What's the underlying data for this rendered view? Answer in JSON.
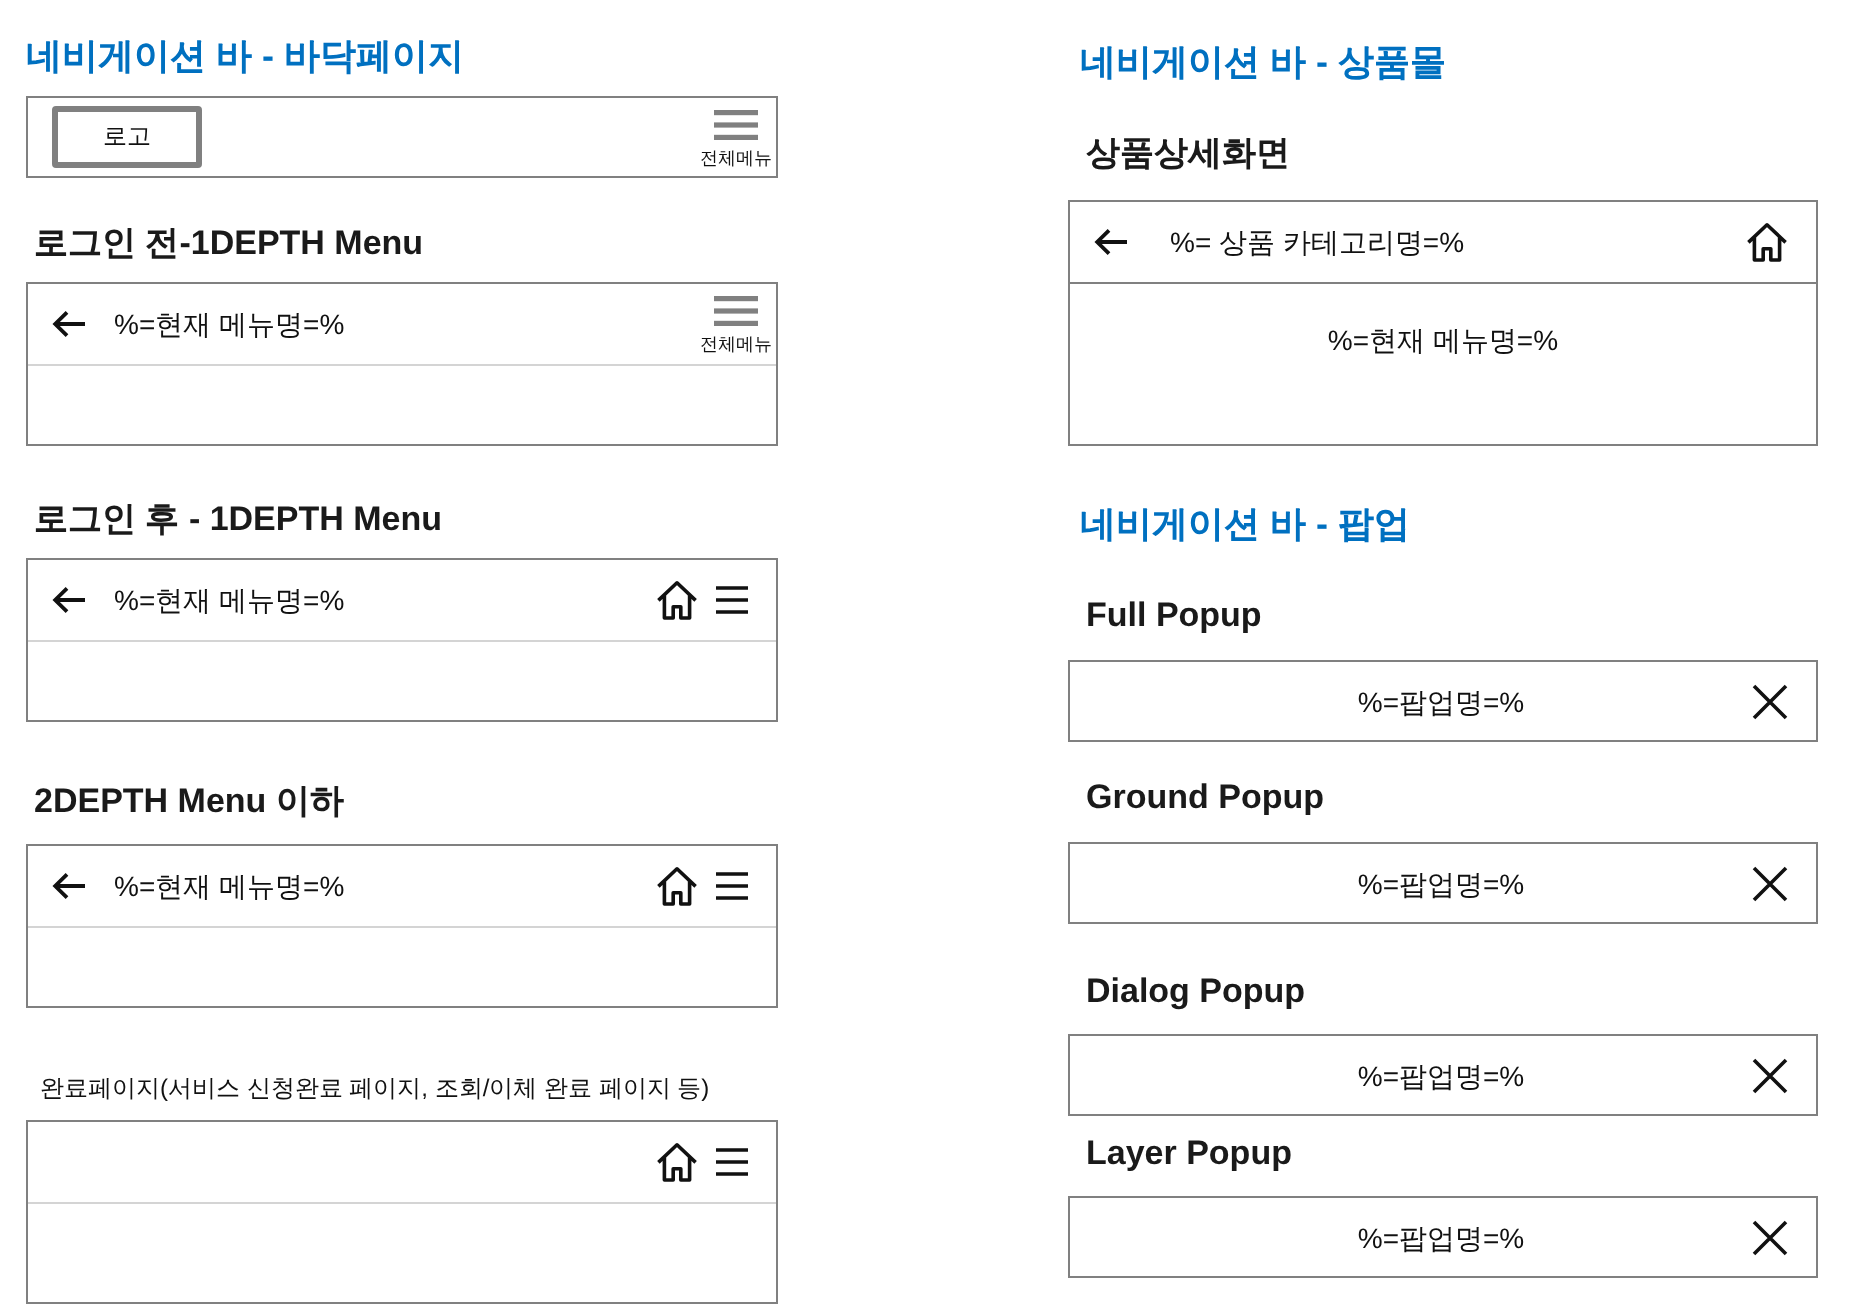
{
  "columns": [
    {
      "sections": [
        {
          "title": "네비게이션 바 - 바닥페이지",
          "bars": [
            {
              "kind": "base",
              "logo": "로고",
              "menu_label": "전체메뉴"
            },
            {
              "kind": "guest",
              "heading": "로그인 전-1DEPTH Menu",
              "title": "%=현재 메뉴명=%",
              "menu_label": "전체메뉴"
            },
            {
              "kind": "member",
              "heading": "로그인 후 - 1DEPTH Menu",
              "title": "%=현재 메뉴명=%"
            },
            {
              "kind": "member",
              "heading": "2DEPTH Menu 이하",
              "title": "%=현재 메뉴명=%"
            },
            {
              "kind": "done",
              "heading": "완료페이지(서비스 신청완료 페이지, 조회/이체 완료 페이지 등)"
            }
          ]
        }
      ]
    },
    {
      "sections": [
        {
          "title": "네비게이션 바 - 상품몰",
          "bars": [
            {
              "kind": "product",
              "heading": "상품상세화면",
              "title": "%= 상품 카테고리명=%",
              "body": "%=현재 메뉴명=%"
            }
          ]
        },
        {
          "title": "네비게이션 바 - 팝업",
          "bars": [
            {
              "kind": "popup",
              "heading": "Full Popup",
              "title": "%=팝업명=%"
            },
            {
              "kind": "popup",
              "heading": "Ground Popup",
              "title": "%=팝업명=%"
            },
            {
              "kind": "popup",
              "heading": "Dialog Popup",
              "title": "%=팝업명=%"
            },
            {
              "kind": "popup",
              "heading": "Layer Popup",
              "title": "%=팝업명=%"
            }
          ]
        }
      ]
    }
  ]
}
